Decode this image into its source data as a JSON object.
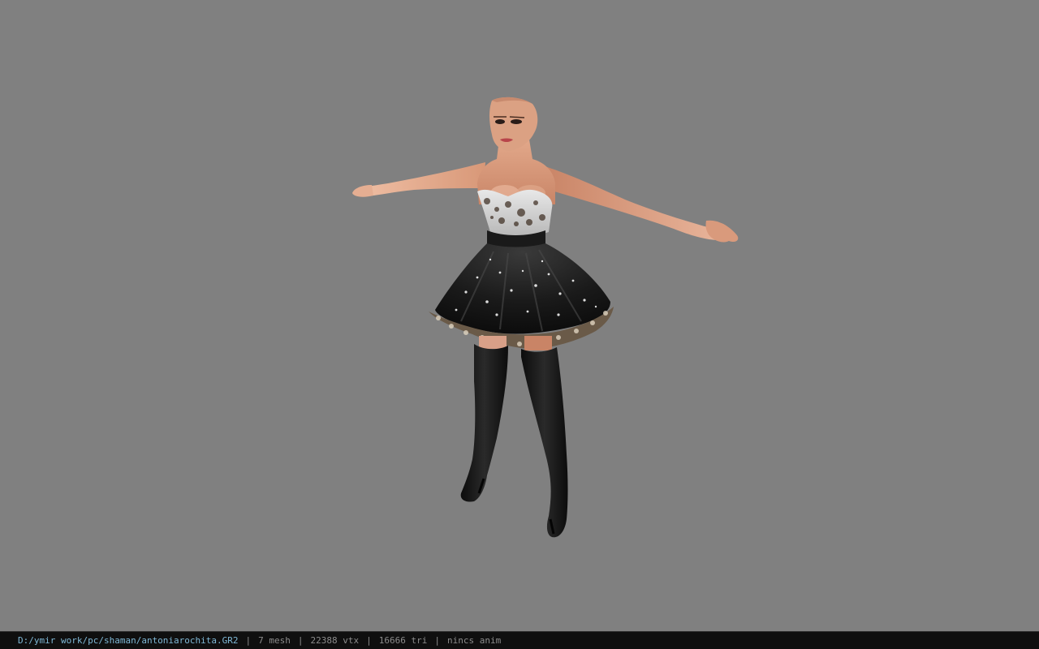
{
  "viewer": {
    "background_color": "#808080",
    "model_type": "female character in strapless black dress and thigh-high boots, T-pose"
  },
  "status_bar": {
    "file_path": "D:/ymir work/pc/shaman/antoniarochita.GR2",
    "separator": "|",
    "mesh_count": "7 mesh",
    "vertex_count": "22388 vtx",
    "triangle_count": "16666 tri",
    "anim_status": "nincs anim",
    "path_color": "#7fb8d6",
    "text_color": "#8c8c8c"
  }
}
